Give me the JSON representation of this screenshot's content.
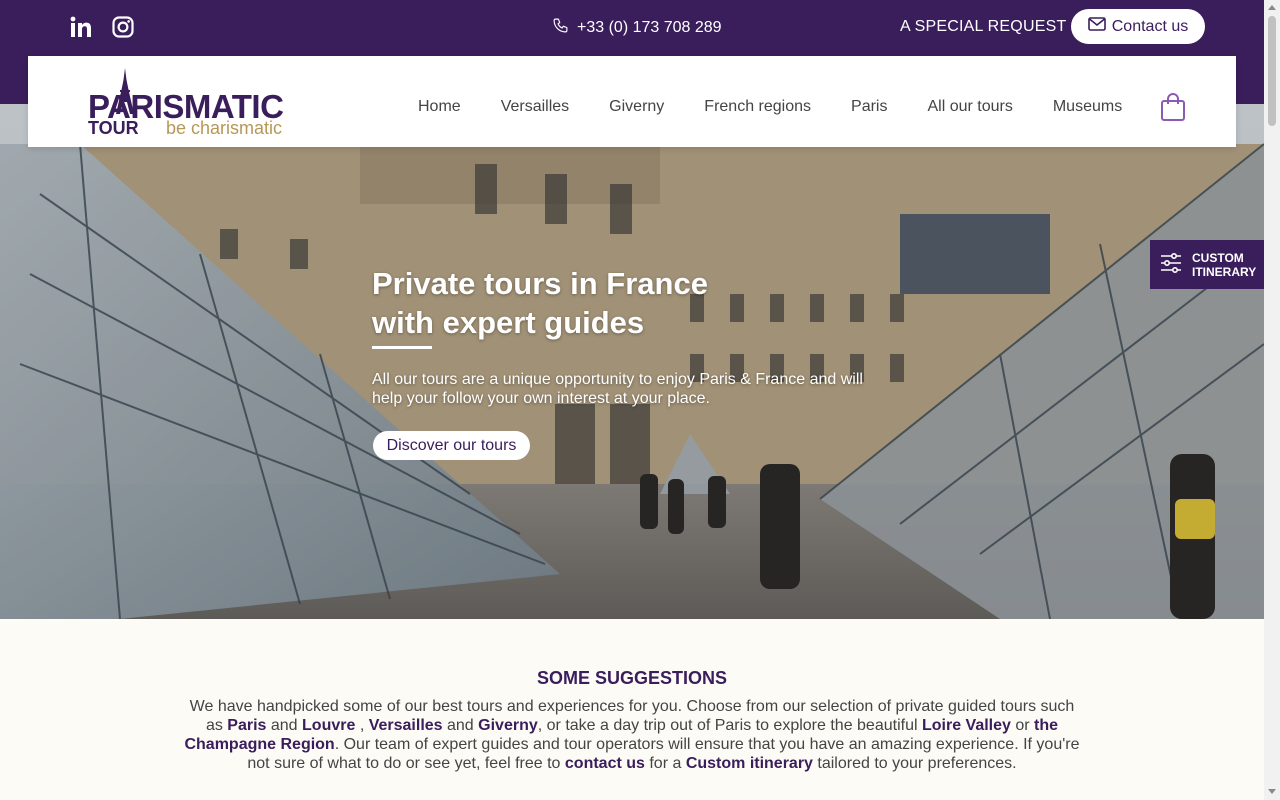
{
  "topbar": {
    "phone": "+33 (0) 173 708 289",
    "special_request": "A SPECIAL REQUEST ?",
    "contact_label": "Contact us",
    "icons": [
      "linkedin-icon",
      "instagram-icon",
      "phone-icon",
      "mail-icon"
    ]
  },
  "logo": {
    "main": "PARISMATIC",
    "sub": "TOUR",
    "tagline": "be charismatic"
  },
  "nav": {
    "items": [
      "Home",
      "Versailles",
      "Giverny",
      "French regions",
      "Paris",
      "All our tours",
      "Museums"
    ],
    "cart_icon": "shopping-bag-icon"
  },
  "hero": {
    "title_line1": "Private tours in France",
    "title_line2": "with expert guides",
    "text": "All our tours are a unique opportunity to enjoy Paris & France and will help your follow your own interest at your place.",
    "button": "Discover our tours"
  },
  "custom_itinerary": {
    "line1": "CUSTOM",
    "line2": "ITINERARY",
    "icon": "sliders-icon"
  },
  "suggestions": {
    "title": "SOME SUGGESTIONS",
    "t1": "We have handpicked some of our best tours and experiences for you. Choose from our selection of private guided tours such as ",
    "paris": "Paris",
    "t2": " and ",
    "louvre": "Louvre",
    "t3": " , ",
    "versailles": "Versailles",
    "t4": " and ",
    "giverny": "Giverny",
    "t5": ", or take a day trip out of Paris to explore the beautiful ",
    "loire": "Loire Valley",
    "t6": " or ",
    "champagne": "the Champagne Region",
    "t7": ". Our team of expert guides and tour operators will ensure that you have an amazing experience. If you're not sure of what to do or see yet, feel free to ",
    "contact": "contact us",
    "t8": " for a ",
    "custom": "Custom itinerary",
    "t9": " tailored to your preferences."
  },
  "colors": {
    "brand_purple": "#3a1d5b",
    "gold": "#b79756",
    "page_bg": "#fdfbf6"
  }
}
